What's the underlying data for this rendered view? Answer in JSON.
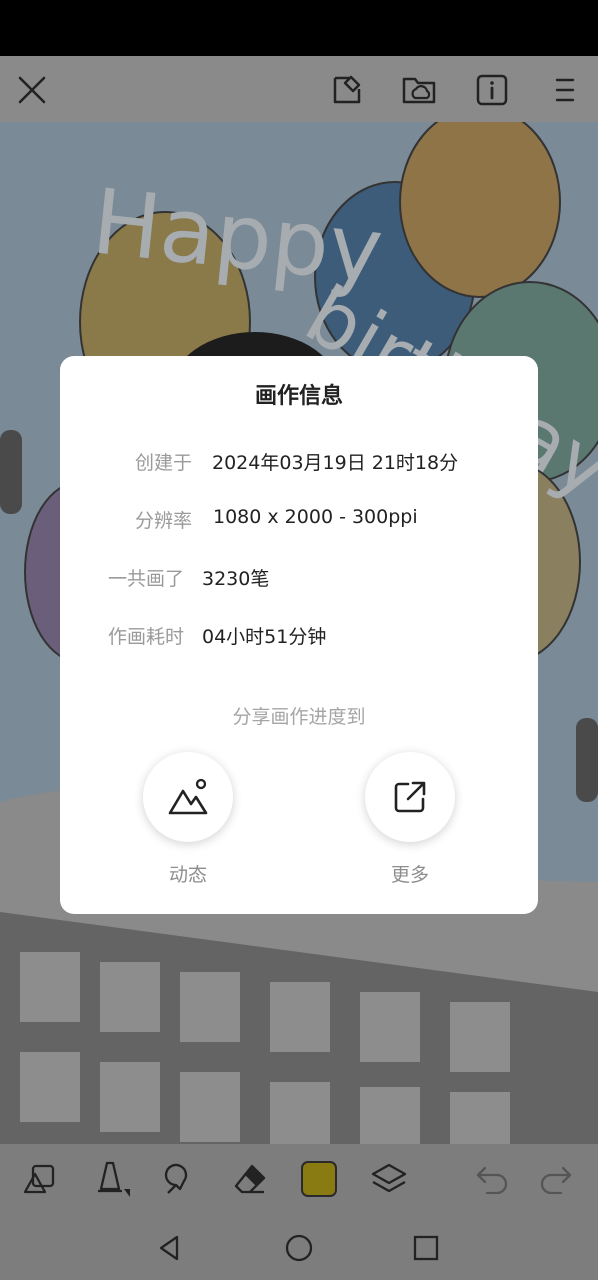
{
  "dialog": {
    "title": "画作信息",
    "rows": [
      {
        "label": "创建于",
        "value": "2024年03月19日 21时18分"
      },
      {
        "label": "分辨率",
        "value": "1080 x 2000 - 300ppi"
      },
      {
        "label": "一共画了",
        "value": "3230笔"
      },
      {
        "label": "作画耗时",
        "value": "04小时51分钟"
      }
    ],
    "share_caption": "分享画作进度到",
    "share_targets": [
      {
        "label": "动态",
        "icon": "mountain-image-icon"
      },
      {
        "label": "更多",
        "icon": "external-share-icon"
      }
    ]
  },
  "artwork": {
    "text_happy": "Happy",
    "text_birthday": "birthday"
  },
  "toolbar": {
    "current_color": "#8a7a12"
  }
}
